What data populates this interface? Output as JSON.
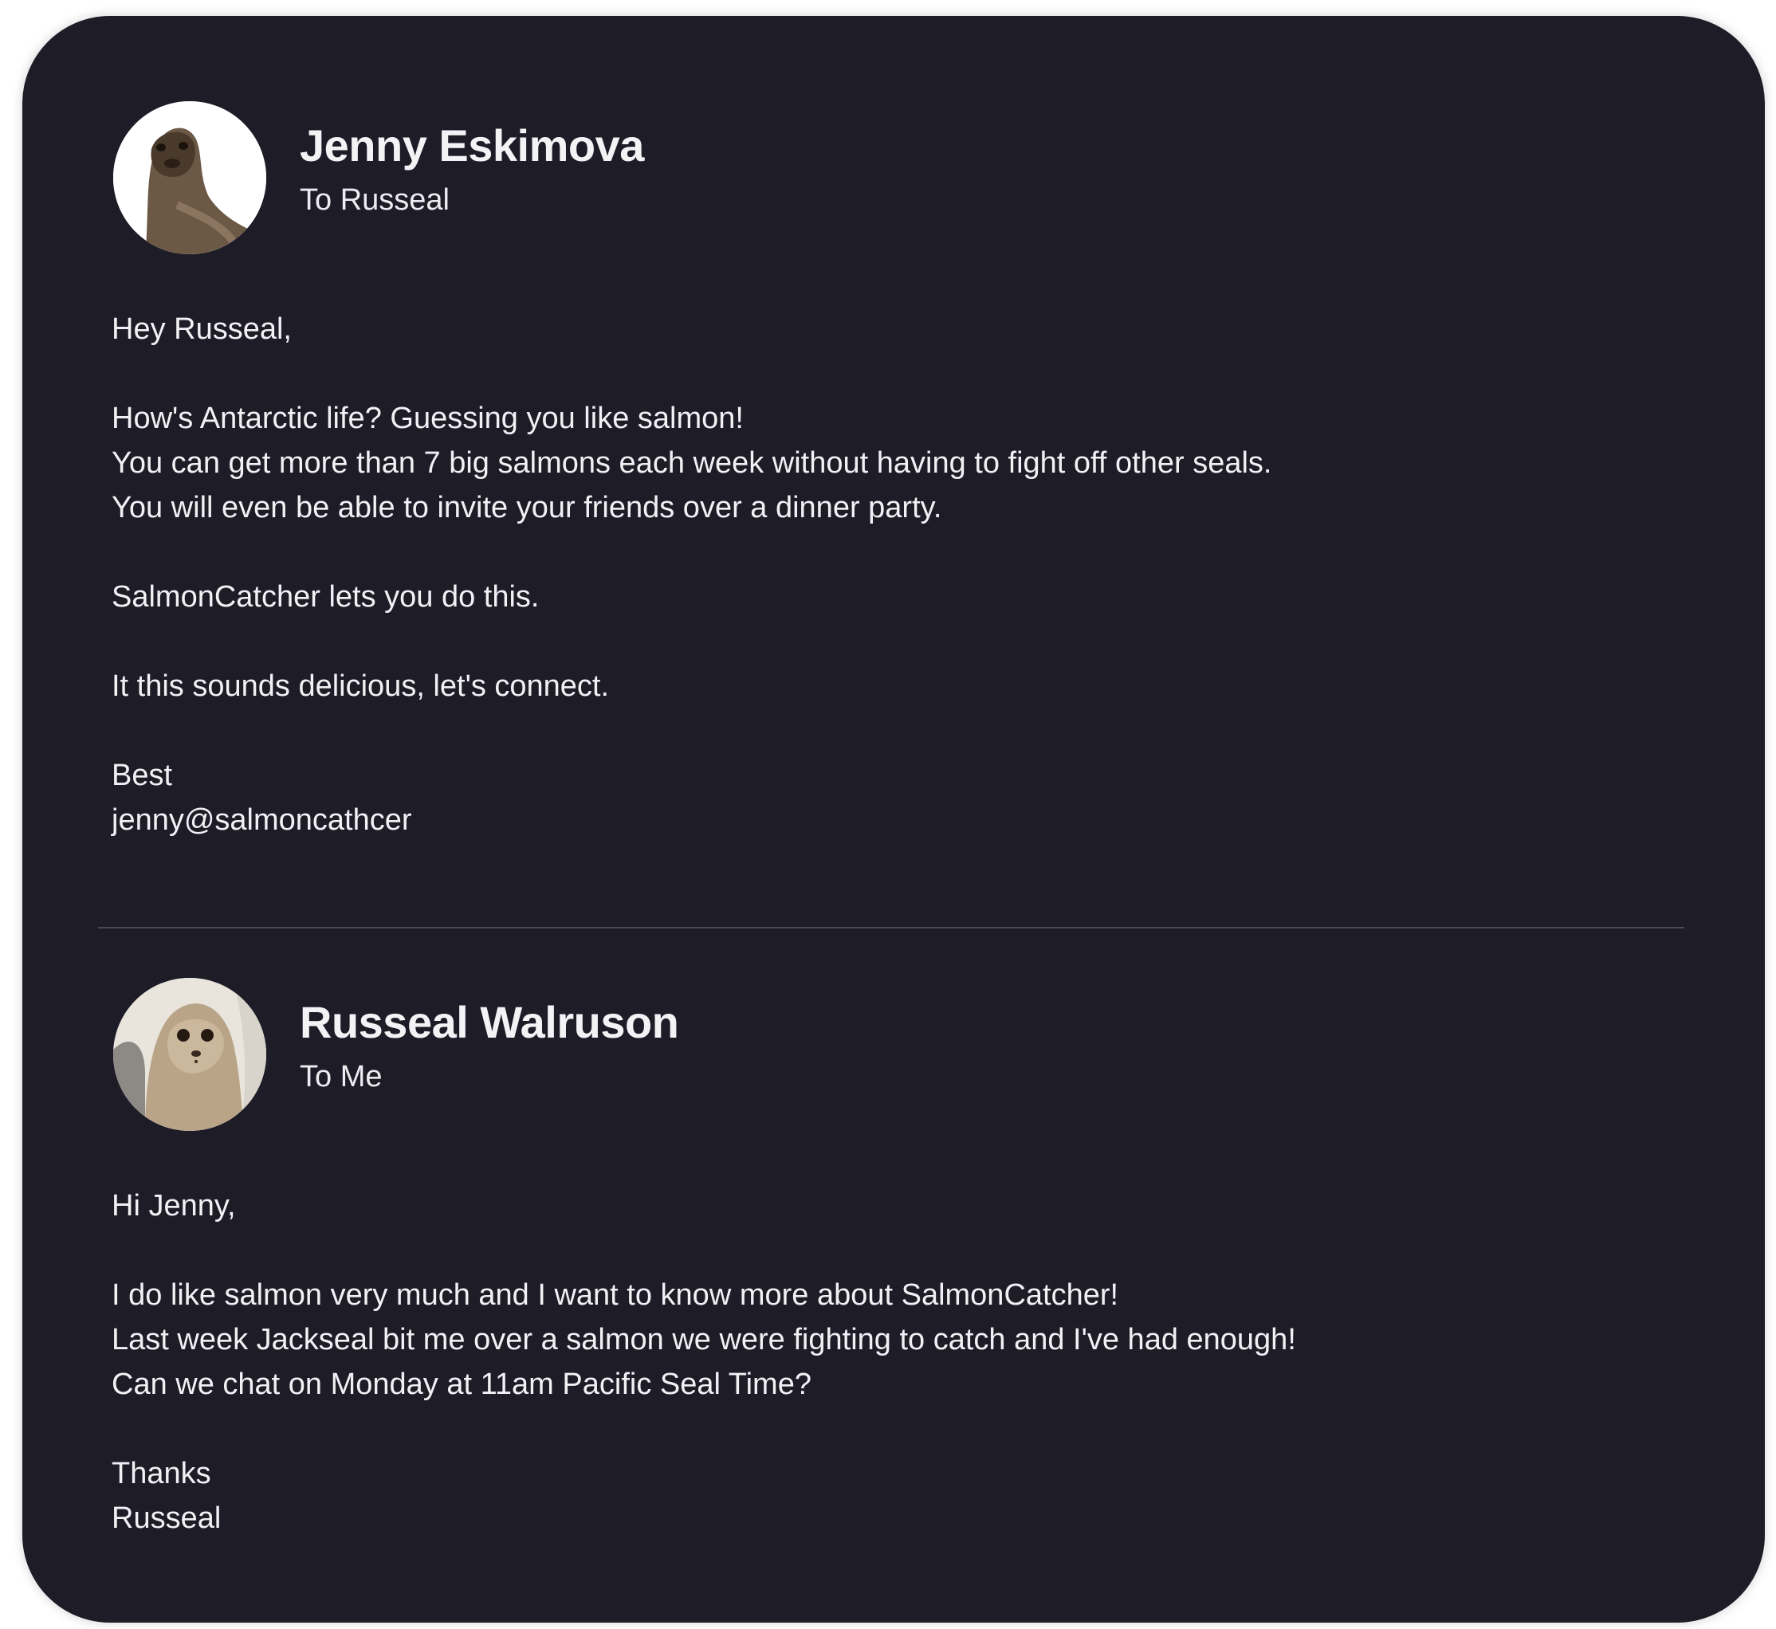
{
  "messages": [
    {
      "sender": "Jenny Eskimova",
      "recipient": "To Russeal",
      "avatar_icon": "seal-avatar-icon",
      "greeting": "Hey Russeal,",
      "paragraph1": [
        "How's Antarctic life? Guessing you like salmon!",
        "You can get more than 7 big salmons each week without having to fight off other seals.",
        "You will even be able to invite your friends over a dinner party."
      ],
      "paragraph2": "SalmonCatcher lets you do this.",
      "paragraph3": "It this sounds delicious, let's connect.",
      "signoff": "Best",
      "signature": "jenny@salmoncathcer"
    },
    {
      "sender": "Russeal Walruson",
      "recipient": "To Me",
      "avatar_icon": "seal-avatar-icon",
      "greeting": "Hi Jenny,",
      "paragraph1": [
        "I do like salmon very much and I want to know more about SalmonCatcher!",
        "Last week Jackseal bit me over a salmon we were fighting to catch and I've had enough!",
        "Can we chat on Monday at 11am Pacific Seal Time?"
      ],
      "signoff": "Thanks",
      "signature": "Russeal"
    }
  ],
  "colors": {
    "card_background": "#1d1c27",
    "text": "#f1f1f5",
    "divider": "#4a4a57"
  }
}
